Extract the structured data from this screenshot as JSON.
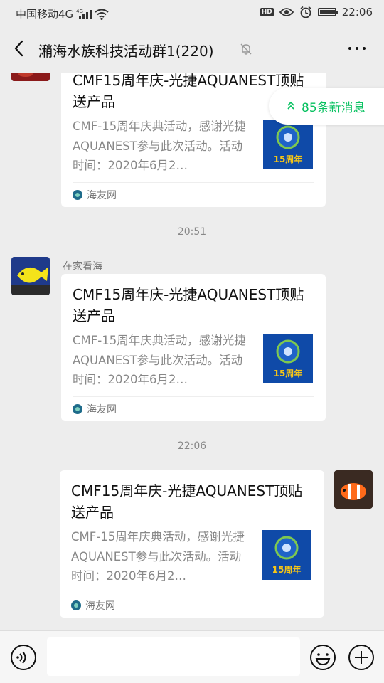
{
  "status_bar": {
    "carrier": "中国移动4G",
    "network": "4G",
    "hd": "HD",
    "battery_level": 0.95,
    "time": "22:06"
  },
  "header": {
    "title": "潲海水族科技活动群1(220)"
  },
  "new_messages": {
    "label": "85条新消息"
  },
  "messages": [
    {
      "side": "left",
      "sender": "",
      "card": {
        "title": "CMF15周年庆-光捷AQUANEST顶贴送产品",
        "desc": "CMF-15周年庆典活动，感谢光捷AQUANEST参与此次活动。活动时间：2020年6月2…",
        "thumb_label": "15周年",
        "source": "海友网"
      }
    },
    {
      "side": "left",
      "sender": "在家看海",
      "card": {
        "title": "CMF15周年庆-光捷AQUANEST顶贴送产品",
        "desc": "CMF-15周年庆典活动，感谢光捷AQUANEST参与此次活动。活动时间：2020年6月2…",
        "thumb_label": "15周年",
        "source": "海友网"
      }
    },
    {
      "side": "right",
      "sender": "",
      "card": {
        "title": "CMF15周年庆-光捷AQUANEST顶贴送产品",
        "desc": "CMF-15周年庆典活动，感谢光捷AQUANEST参与此次活动。活动时间：2020年6月2…",
        "thumb_label": "15周年",
        "source": "海友网"
      }
    }
  ],
  "timestamps": [
    "20:51",
    "22:06"
  ],
  "input_bar": {
    "text": ""
  },
  "colors": {
    "background": "#ededed",
    "accent_green": "#07c160",
    "card": "#ffffff"
  }
}
